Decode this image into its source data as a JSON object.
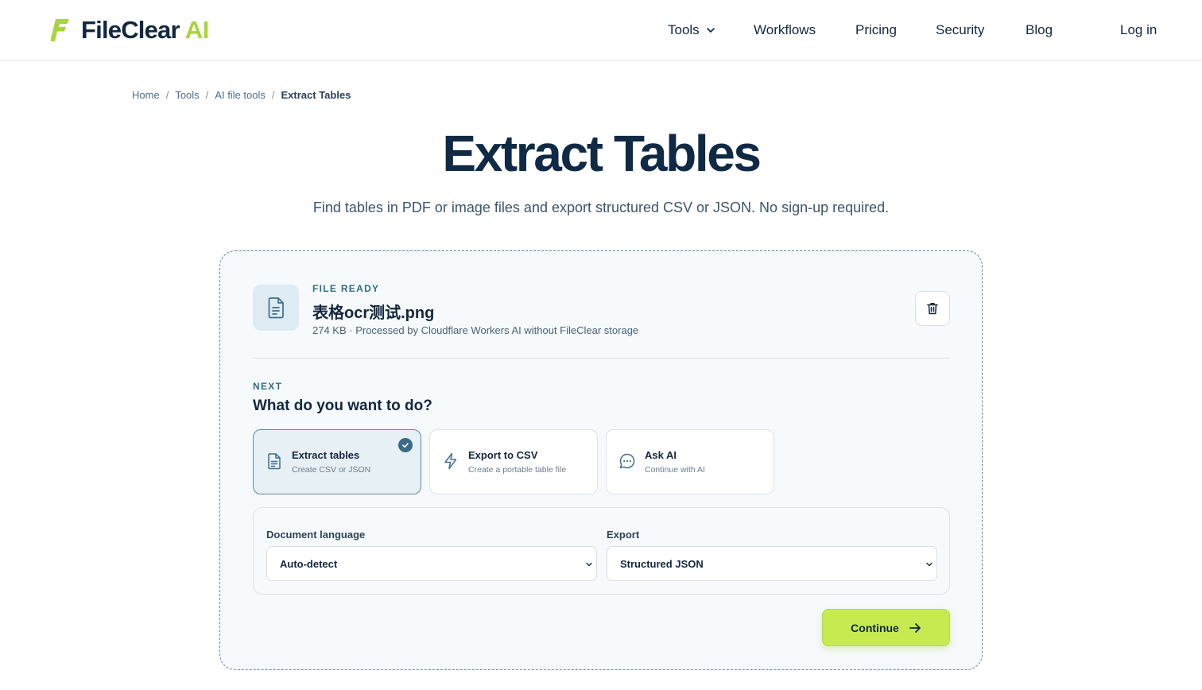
{
  "header": {
    "brand_name": "FileClear",
    "brand_suffix": "AI",
    "nav": [
      {
        "label": "Tools"
      },
      {
        "label": "Workflows"
      },
      {
        "label": "Pricing"
      },
      {
        "label": "Security"
      },
      {
        "label": "Blog"
      }
    ],
    "login_label": "Log in"
  },
  "breadcrumb": [
    "Home",
    "Tools",
    "AI file tools",
    "Extract Tables"
  ],
  "page": {
    "title": "Extract Tables",
    "subtitle": "Find tables in PDF or image files and export structured CSV or JSON. No sign-up required."
  },
  "file": {
    "status": "FILE READY",
    "name": "表格ocr测试.png",
    "meta": "274 KB · Processed by Cloudflare Workers AI without FileClear storage"
  },
  "next": {
    "label": "NEXT",
    "question": "What do you want to do?",
    "options": [
      {
        "title": "Extract tables",
        "subtitle": "Create CSV or JSON",
        "icon": "document-icon",
        "selected": true
      },
      {
        "title": "Export to CSV",
        "subtitle": "Create a portable table file",
        "icon": "lightning-icon",
        "selected": false
      },
      {
        "title": "Ask AI",
        "subtitle": "Continue with AI",
        "icon": "chat-icon",
        "selected": false
      }
    ]
  },
  "settings": {
    "language_label": "Document language",
    "language_value": "Auto-detect",
    "export_label": "Export",
    "export_value": "Structured JSON"
  },
  "continue_label": "Continue",
  "colors": {
    "brand_accent": "#a6d63b",
    "button": "#c6ea50",
    "primary_text": "#13273f",
    "selected_border": "#5d8aa8"
  }
}
